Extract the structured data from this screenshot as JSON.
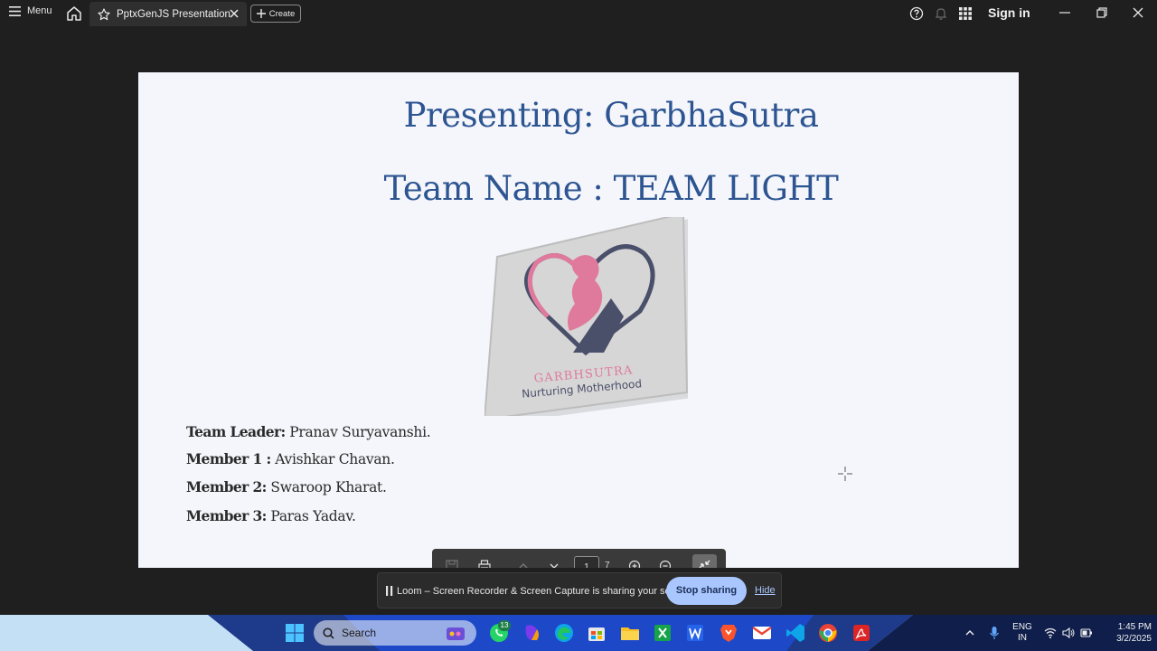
{
  "topbar": {
    "menu_label": "Menu",
    "tab_title": "PptxGenJS Presentation",
    "create_label": "Create",
    "signin_label": "Sign in"
  },
  "slide": {
    "title_line1": "Presenting: GarbhaSutra",
    "title_line2": "Team Name : TEAM LIGHT",
    "logo": {
      "brand": "GARBHSUTRA",
      "tagline": "Nurturing Motherhood"
    },
    "members": [
      {
        "role": "Team Leader:",
        "name": " Pranav Suryavanshi."
      },
      {
        "role": "Member 1 :",
        "name": "  Avishkar Chavan."
      },
      {
        "role": "Member 2:",
        "name": " Swaroop Kharat."
      },
      {
        "role": "Member 3:",
        "name": " Paras Yadav."
      }
    ]
  },
  "pdf_toolbar": {
    "current_page": "1",
    "total_pages": "7"
  },
  "loom": {
    "message": "Loom – Screen Recorder & Screen Capture is sharing your screen.",
    "stop_label": "Stop sharing",
    "hide_label": "Hide"
  },
  "taskbar": {
    "search_label": "Search",
    "whatsapp_badge": "13",
    "lang_line1": "ENG",
    "lang_line2": "IN",
    "time": "1:45 PM",
    "date": "3/2/2025"
  },
  "colors": {
    "title_blue": "#2d5592",
    "logo_pink": "#e07a9c",
    "logo_navy": "#4a4f6a",
    "loom_button": "#a9c6ff"
  }
}
